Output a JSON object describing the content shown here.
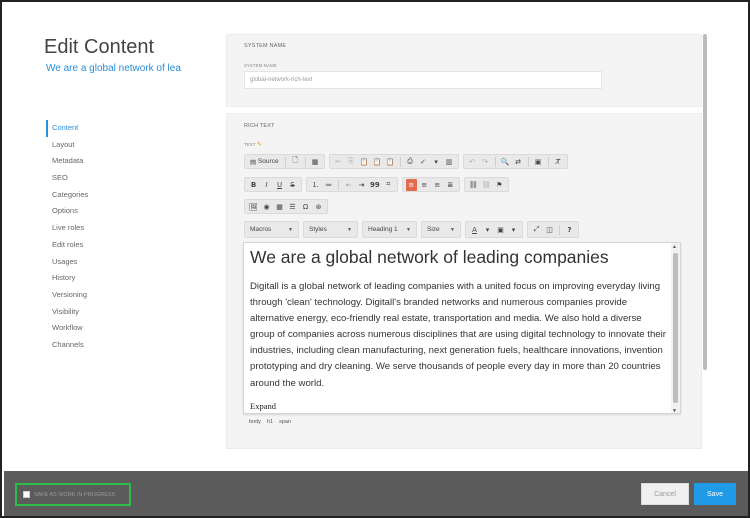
{
  "header": {
    "title": "Edit Content",
    "subtitle": "We are a global network of lea"
  },
  "nav": {
    "items": [
      "Content",
      "Layout",
      "Metadata",
      "SEO",
      "Categories",
      "Options",
      "Live roles",
      "Edit roles",
      "Usages",
      "History",
      "Versioning",
      "Visibility",
      "Workflow",
      "Channels"
    ],
    "active": "Content"
  },
  "system_name": {
    "section_label": "SYSTEM NAME",
    "field_label": "SYSTEM NAME",
    "value": "global-network-rich-text"
  },
  "rich_text": {
    "section_label": "RICH TEXT",
    "field_label": "TEXT",
    "toolbar": {
      "source_label": "Source",
      "macros_label": "Macros",
      "styles_label": "Styles",
      "format_label": "Heading 1",
      "size_label": "Size",
      "text_color_label": "A",
      "quote_glyph": "99",
      "help_glyph": "?"
    },
    "heading": "We are a global network of leading companies",
    "body": "Digitall is a global network of leading companies with a united focus on improving everyday living through 'clean' technology. Digitall's branded networks and numerous companies provide alternative energy, eco-friendly real estate, transportation and media. We also hold a diverse group of companies across numerous disciplines that are using digital technology to innovate their industries, including clean manufacturing, next generation fuels, healthcare innovations, invention prototyping and dry cleaning. We serve thousands of people every day in more than 20 countries around the world.",
    "expand_label": "Expand",
    "path": [
      "body",
      "h1",
      "span"
    ]
  },
  "footer": {
    "wip_label": "SAVE AS WORK IN PROGRESS",
    "cancel_label": "Cancel",
    "save_label": "Save"
  },
  "colors": {
    "accent": "#2a8fd6",
    "save_button": "#1e9ae6",
    "active_align": "#e46a4d",
    "wip_highlight": "#2fbd4a",
    "footer_bg": "#5b5b5b"
  }
}
